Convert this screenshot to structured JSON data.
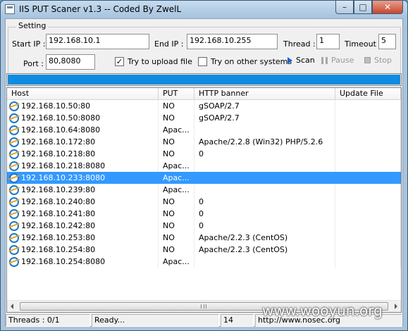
{
  "window": {
    "title": "IIS PUT Scaner v1.3 -- Coded By ZwelL",
    "controls": {
      "minimize": "–",
      "maximize": "□",
      "close": "✕"
    }
  },
  "settings": {
    "group_title": "Setting",
    "start_ip_label": "Start IP :",
    "start_ip_value": "192.168.10.1",
    "end_ip_label": "End IP :",
    "end_ip_value": "192.168.10.255",
    "thread_label": "Thread :",
    "thread_value": "1",
    "timeout_label": "Timeout :",
    "timeout_value": "5",
    "port_label": "Port :",
    "port_value": "80,8080",
    "upload_label": "Try to upload file",
    "upload_checked": true,
    "other_systems_label": "Try on other systems",
    "other_systems_checked": false
  },
  "toolbar": {
    "scan_label": "Scan",
    "pause_label": "Pause",
    "stop_label": "Stop",
    "scan_icon": "play-icon",
    "pause_icon": "pause-icon",
    "stop_icon": "stop-icon"
  },
  "progress": {
    "value_percent": 100,
    "fill_color": "#0f8be0"
  },
  "table": {
    "columns": [
      "Host",
      "PUT",
      "HTTP banner",
      "Update File"
    ],
    "selected_index": 6,
    "rows": [
      {
        "host": "192.168.10.50:80",
        "put": "NO",
        "banner": "gSOAP/2.7",
        "update": ""
      },
      {
        "host": "192.168.10.50:8080",
        "put": "NO",
        "banner": "gSOAP/2.7",
        "update": ""
      },
      {
        "host": "192.168.10.64:8080",
        "put": "Apac...",
        "banner": "",
        "update": ""
      },
      {
        "host": "192.168.10.172:80",
        "put": "NO",
        "banner": "Apache/2.2.8 (Win32) PHP/5.2.6",
        "update": ""
      },
      {
        "host": "192.168.10.218:80",
        "put": "NO",
        "banner": "0",
        "update": ""
      },
      {
        "host": "192.168.10.218:8080",
        "put": "Apac...",
        "banner": "",
        "update": ""
      },
      {
        "host": "192.168.10.233:8080",
        "put": "Apac...",
        "banner": "",
        "update": ""
      },
      {
        "host": "192.168.10.239:80",
        "put": "Apac...",
        "banner": "",
        "update": ""
      },
      {
        "host": "192.168.10.240:80",
        "put": "NO",
        "banner": "0",
        "update": ""
      },
      {
        "host": "192.168.10.241:80",
        "put": "NO",
        "banner": "0",
        "update": ""
      },
      {
        "host": "192.168.10.242:80",
        "put": "NO",
        "banner": "0",
        "update": ""
      },
      {
        "host": "192.168.10.253:80",
        "put": "NO",
        "banner": "Apache/2.2.3 (CentOS)",
        "update": ""
      },
      {
        "host": "192.168.10.254:80",
        "put": "NO",
        "banner": "Apache/2.2.3 (CentOS)",
        "update": ""
      },
      {
        "host": "192.168.10.254:8080",
        "put": "Apac...",
        "banner": "",
        "update": ""
      }
    ]
  },
  "status": {
    "threads": "Threads : 0/1",
    "state": "Ready...",
    "count": "14",
    "url": "http://www.nosec.org"
  },
  "watermark": "www.wooyun.org",
  "colors": {
    "selection": "#3399ff",
    "progress": "#0f8be0",
    "scan_icon": "#1f64c8"
  }
}
